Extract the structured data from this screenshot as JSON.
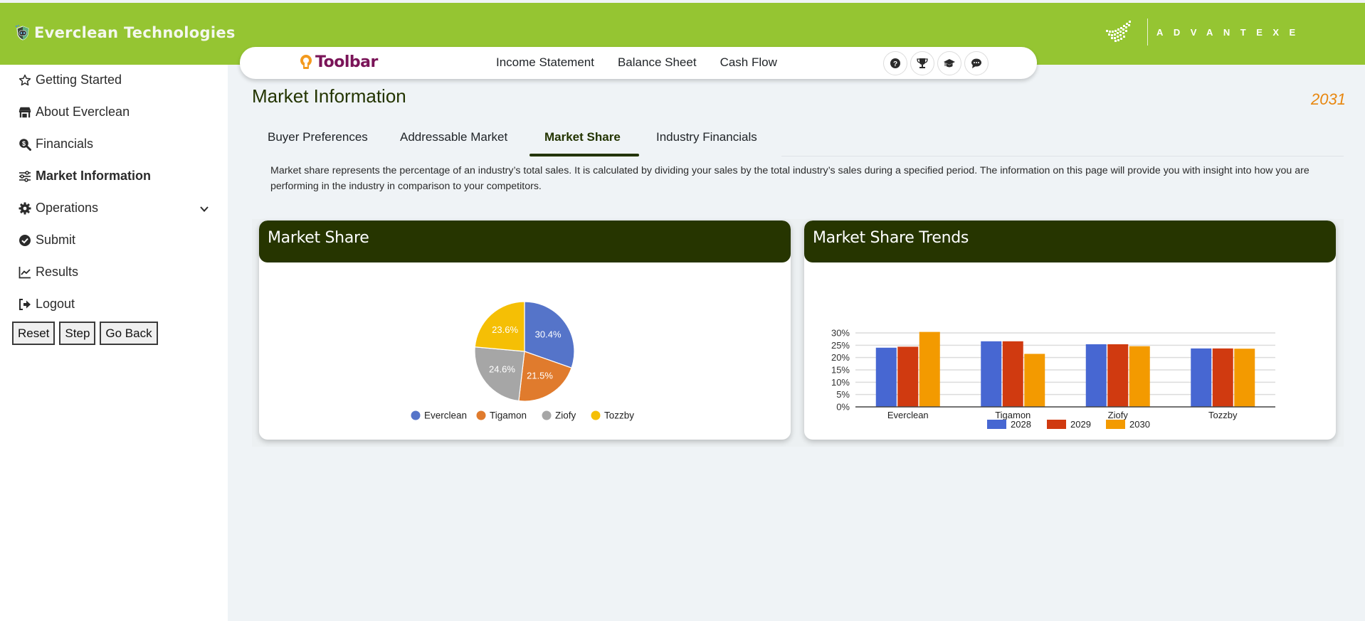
{
  "header": {
    "brand_name": "Everclean Technologies",
    "partner_logo_text": "ADVANTEXE"
  },
  "toolbar": {
    "label": "Toolbar",
    "links": [
      "Income Statement",
      "Balance Sheet",
      "Cash Flow"
    ],
    "icons": [
      "help-icon",
      "trophy-icon",
      "graduation-cap-icon",
      "chat-icon"
    ]
  },
  "sidebar": {
    "items": [
      {
        "label": "Getting Started",
        "icon": "star-icon",
        "active": false
      },
      {
        "label": "About Everclean",
        "icon": "store-icon",
        "active": false
      },
      {
        "label": "Financials",
        "icon": "search-dollar-icon",
        "active": false
      },
      {
        "label": "Market Information",
        "icon": "sliders-icon",
        "active": true
      },
      {
        "label": "Operations",
        "icon": "gear-icon",
        "active": false,
        "expandable": true
      },
      {
        "label": "Submit",
        "icon": "check-circle-icon",
        "active": false
      },
      {
        "label": "Results",
        "icon": "chart-line-icon",
        "active": false
      },
      {
        "label": "Logout",
        "icon": "logout-icon",
        "active": false
      }
    ],
    "buttons": [
      "Reset",
      "Step",
      "Go Back"
    ]
  },
  "main": {
    "title": "Market Information",
    "year": "2031",
    "tabs": [
      {
        "label": "Buyer Preferences",
        "active": false
      },
      {
        "label": "Addressable Market",
        "active": false
      },
      {
        "label": "Market Share",
        "active": true
      },
      {
        "label": "Industry Financials",
        "active": false
      }
    ],
    "description": "Market share represents the percentage of an industry’s total sales. It is calculated by dividing your sales by the total industry’s sales during a specified period. The information on this page will provide you with insight into how you are performing in the industry in comparison to your competitors.",
    "cards": [
      {
        "title": "Market Share"
      },
      {
        "title": "Market Share Trends"
      }
    ]
  },
  "chart_data": [
    {
      "type": "pie",
      "title": "Market Share",
      "categories": [
        "Everclean",
        "Tigamon",
        "Ziofy",
        "Tozzby"
      ],
      "values": [
        30.4,
        21.5,
        24.6,
        23.6
      ],
      "labels": [
        "30.4%",
        "21.5%",
        "24.6%",
        "23.6%"
      ],
      "colors": [
        "#5574c9",
        "#e07b2d",
        "#a6a6a6",
        "#f5bf05"
      ],
      "legend": "bottom"
    },
    {
      "type": "bar",
      "title": "Market Share Trends",
      "categories": [
        "Everclean",
        "Tigamon",
        "Ziofy",
        "Tozzby"
      ],
      "series": [
        {
          "name": "2028",
          "color": "#4767d2",
          "values": [
            24.0,
            26.6,
            25.4,
            23.7
          ]
        },
        {
          "name": "2029",
          "color": "#d03a10",
          "values": [
            24.4,
            26.6,
            25.4,
            23.7
          ]
        },
        {
          "name": "2030",
          "color": "#f39a00",
          "values": [
            30.4,
            21.5,
            24.6,
            23.6
          ]
        }
      ],
      "yticks": [
        "0%",
        "5%",
        "10%",
        "15%",
        "20%",
        "25%",
        "30%"
      ],
      "ylim": [
        0,
        30
      ],
      "grid": true,
      "legend": "bottom",
      "xlabel": "",
      "ylabel": ""
    }
  ]
}
